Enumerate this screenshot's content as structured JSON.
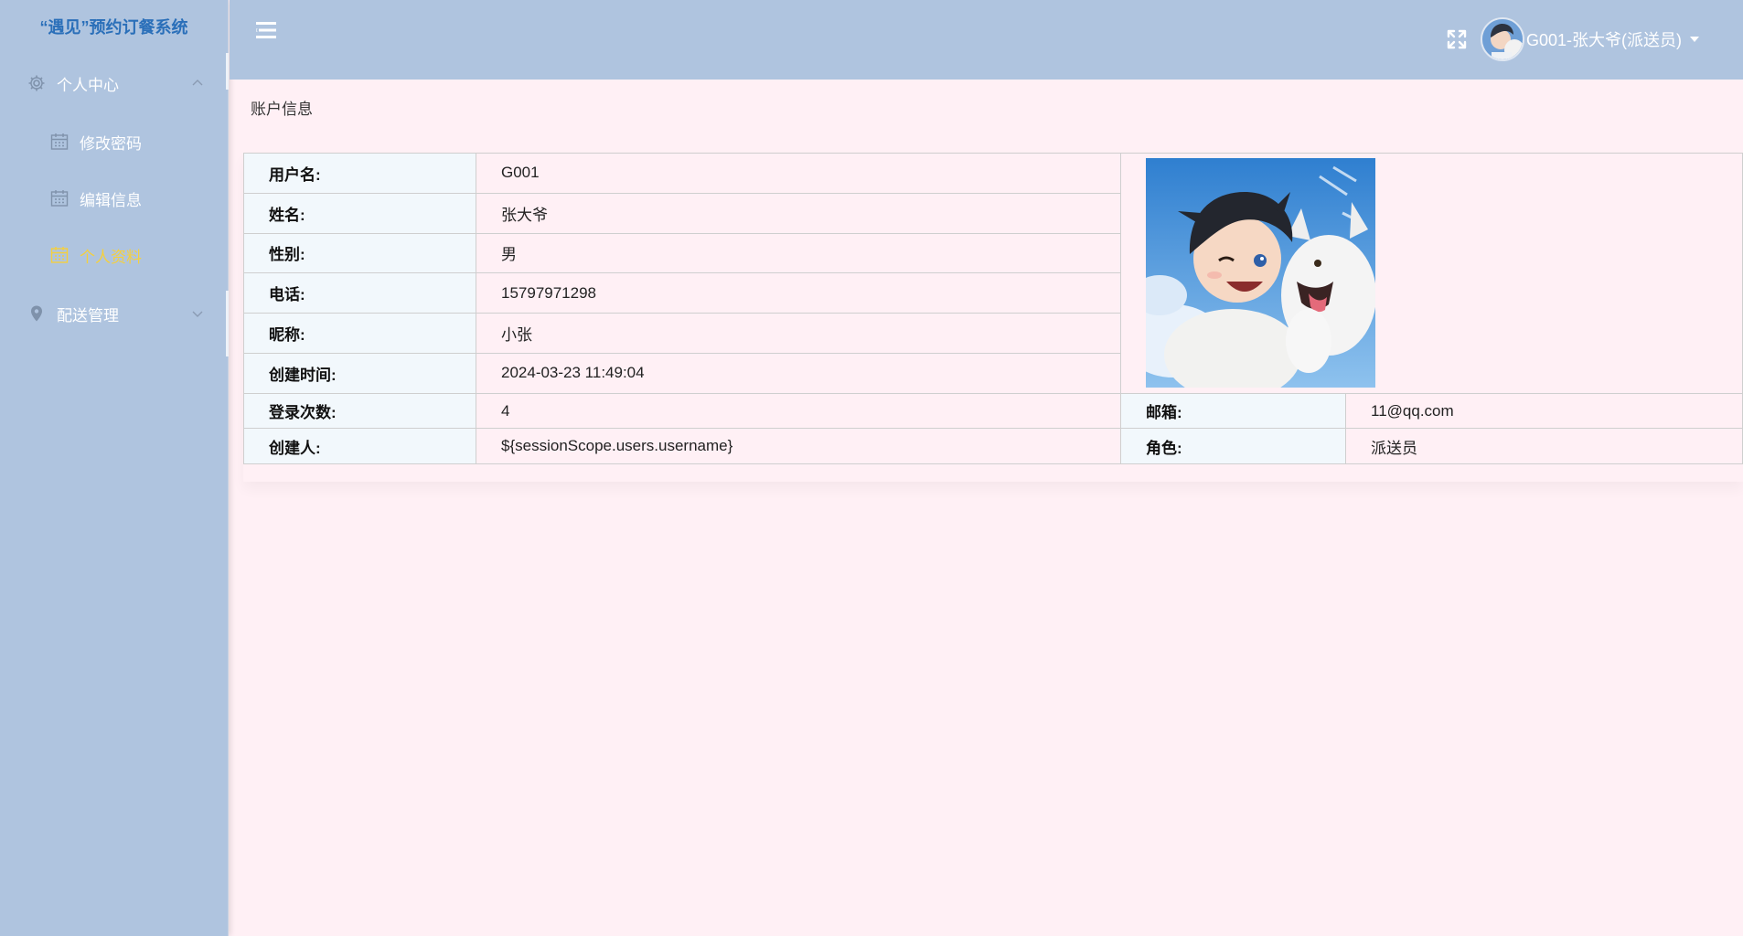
{
  "app": {
    "brand": "“遇见”预约订餐系统"
  },
  "sidebar": {
    "groups": [
      {
        "label": "个人中心",
        "icon": "gear-icon",
        "expanded": true,
        "items": [
          {
            "label": "修改密码",
            "icon": "calendar-icon",
            "active": false
          },
          {
            "label": "编辑信息",
            "icon": "calendar-icon",
            "active": false
          },
          {
            "label": "个人资料",
            "icon": "calendar-icon",
            "active": true
          }
        ]
      },
      {
        "label": "配送管理",
        "icon": "location-pin-icon",
        "expanded": false,
        "items": []
      }
    ]
  },
  "header": {
    "user_label": "G001-张大爷(派送员)"
  },
  "page": {
    "breadcrumb": "账户信息"
  },
  "profile": {
    "rows": [
      {
        "label": "用户名:",
        "value": "G001"
      },
      {
        "label": "姓名:",
        "value": "张大爷"
      },
      {
        "label": "性别:",
        "value": "男"
      },
      {
        "label": "电话:",
        "value": "15797971298"
      },
      {
        "label": "昵称:",
        "value": "小张"
      },
      {
        "label": "创建时间:",
        "value": "2024-03-23 11:49:04"
      }
    ],
    "login_count_label": "登录次数:",
    "login_count_value": "4",
    "email_label": "邮箱:",
    "email_value": "11@qq.com",
    "creator_label": "创建人:",
    "creator_value": "${sessionScope.users.username}",
    "role_label": "角色:",
    "role_value": "派送员"
  },
  "colors": {
    "sidebar_bg": "#afc4df",
    "content_bg": "#fff0f5",
    "label_bg": "#f2f8fc",
    "active_menu": "#f4d03f",
    "brand_text": "#2a6fb9"
  }
}
